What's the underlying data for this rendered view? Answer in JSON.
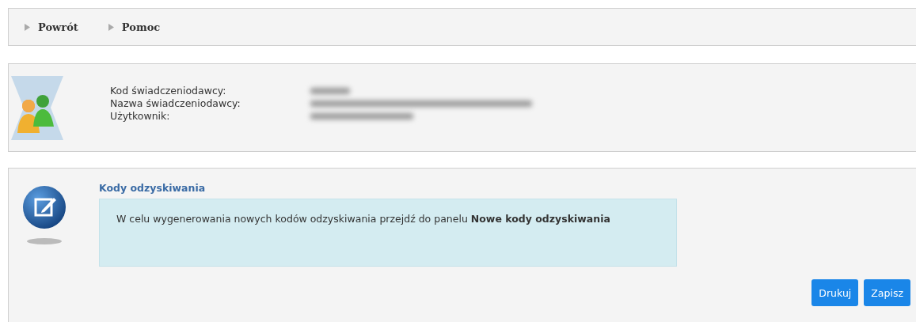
{
  "toolbar": {
    "links": [
      {
        "label": "Powrót"
      },
      {
        "label": "Pomoc"
      }
    ]
  },
  "provider_info": {
    "fields": [
      {
        "label": "Kod świadczeniodawcy:"
      },
      {
        "label": "Nazwa świadczeniodawcy:"
      },
      {
        "label": "Użytkownik:"
      }
    ]
  },
  "recovery_panel": {
    "title": "Kody odzyskiwania",
    "message": "W celu wygenerowania nowych kodów odzyskiwania przejdź do panelu **Nowe kody odzyskiwania**"
  },
  "buttons": [
    {
      "label": "Drukuj"
    },
    {
      "label": "Zapisz"
    }
  ]
}
